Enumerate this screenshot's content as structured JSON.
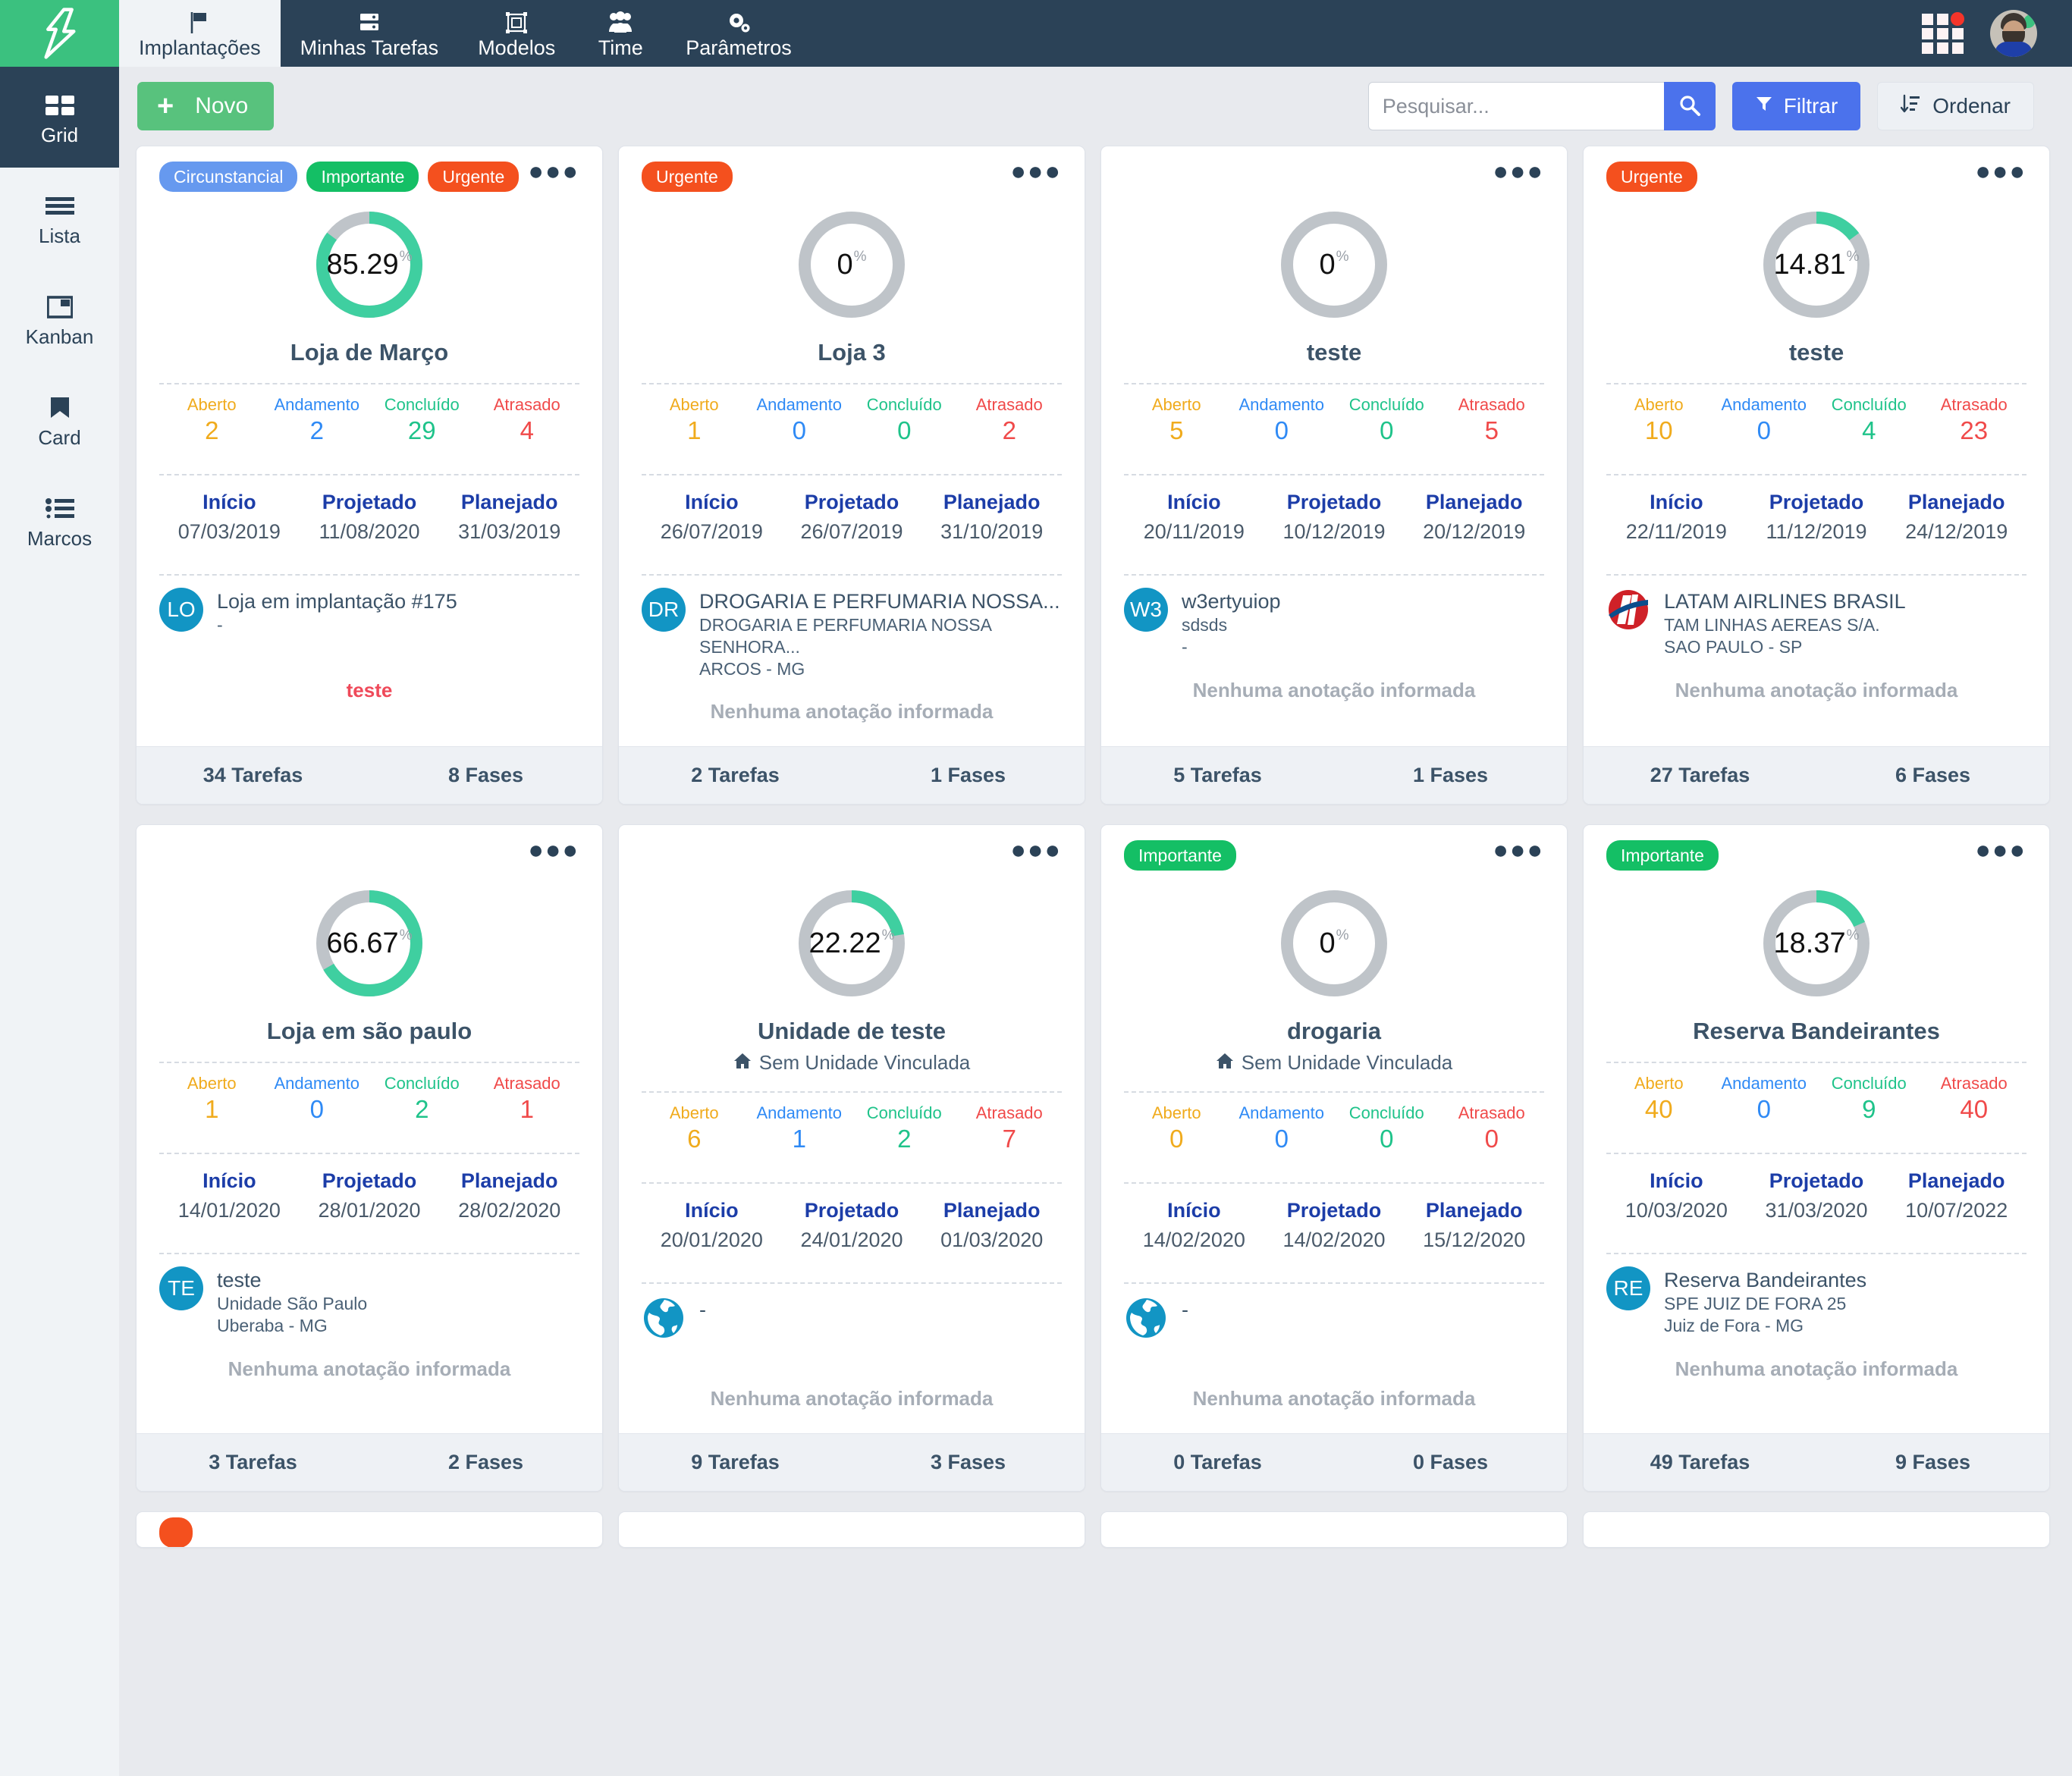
{
  "topnav": {
    "logo": "logo-mark",
    "items": [
      {
        "label": "Implantações",
        "icon": "flag-icon",
        "active": true
      },
      {
        "label": "Minhas Tarefas",
        "icon": "tasks-icon",
        "active": false
      },
      {
        "label": "Modelos",
        "icon": "template-icon",
        "active": false
      },
      {
        "label": "Time",
        "icon": "people-icon",
        "active": false
      },
      {
        "label": "Parâmetros",
        "icon": "gears-icon",
        "active": false
      }
    ],
    "apps_icon": "grid-apps-icon",
    "avatar": "user-avatar"
  },
  "sidebar": {
    "items": [
      {
        "label": "Grid",
        "icon": "grid-view-icon",
        "active": true
      },
      {
        "label": "Lista",
        "icon": "list-view-icon",
        "active": false
      },
      {
        "label": "Kanban",
        "icon": "kanban-view-icon",
        "active": false
      },
      {
        "label": "Card",
        "icon": "bookmark-icon",
        "active": false
      },
      {
        "label": "Marcos",
        "icon": "milestones-icon",
        "active": false
      }
    ]
  },
  "toolbar": {
    "new_label": "Novo",
    "new_icon": "plus-icon",
    "search_placeholder": "Pesquisar...",
    "search_value": "",
    "search_icon": "search-icon",
    "filter_label": "Filtrar",
    "filter_icon": "funnel-icon",
    "sort_label": "Ordenar",
    "sort_icon": "sort-desc-icon"
  },
  "labels": {
    "aberto": "Aberto",
    "andamento": "Andamento",
    "concluido": "Concluído",
    "atrasado": "Atrasado",
    "inicio": "Início",
    "projetado": "Projetado",
    "planejado": "Planejado",
    "no_note": "Nenhuma anotação informada",
    "tarefas_suffix": "Tarefas",
    "fases_suffix": "Fases"
  },
  "colors": {
    "brand_green": "#3bc17f",
    "nav_dark": "#2b4257",
    "accent_blue": "#4b72ec",
    "tag_circunstancial": "#6699ef",
    "tag_importante": "#14bf65",
    "tag_urgente": "#f4501e",
    "donut_fill": "#3fcfa0",
    "donut_track": "#bfc4c9",
    "stat_aberto": "#f0ab1d",
    "stat_andamento": "#2f8af5",
    "stat_concluido": "#1fc38a",
    "stat_atrasado": "#f04a4a"
  },
  "cards": [
    {
      "tags": [
        {
          "text": "Circunstancial",
          "kind": "circ"
        },
        {
          "text": "Importante",
          "kind": "imp"
        },
        {
          "text": "Urgente",
          "kind": "urg"
        }
      ],
      "percent": "85.29",
      "percent_value": 85.29,
      "title": "Loja de Março",
      "subtitle": "",
      "stats": {
        "aberto": "2",
        "andamento": "2",
        "concluido": "29",
        "atrasado": "4"
      },
      "dates": {
        "inicio": "07/03/2019",
        "projetado": "11/08/2020",
        "planejado": "31/03/2019"
      },
      "owner": {
        "avatar_type": "initials",
        "initials": "LO",
        "l1": "Loja em implantação #175",
        "l2": "-",
        "l3": ""
      },
      "note": "teste",
      "note_kind": "red",
      "foot_tasks": "34 Tarefas",
      "foot_phases": "8 Fases"
    },
    {
      "tags": [
        {
          "text": "Urgente",
          "kind": "urg"
        }
      ],
      "percent": "0",
      "percent_value": 0,
      "title": "Loja 3",
      "subtitle": "",
      "stats": {
        "aberto": "1",
        "andamento": "0",
        "concluido": "0",
        "atrasado": "2"
      },
      "dates": {
        "inicio": "26/07/2019",
        "projetado": "26/07/2019",
        "planejado": "31/10/2019"
      },
      "owner": {
        "avatar_type": "initials",
        "initials": "DR",
        "l1": "DROGARIA E PERFUMARIA NOSSA...",
        "l2": "DROGARIA E PERFUMARIA NOSSA SENHORA...",
        "l3": "ARCOS - MG"
      },
      "note": "Nenhuma anotação informada",
      "note_kind": "muted",
      "foot_tasks": "2 Tarefas",
      "foot_phases": "1 Fases"
    },
    {
      "tags": [],
      "percent": "0",
      "percent_value": 0,
      "title": "teste",
      "subtitle": "",
      "stats": {
        "aberto": "5",
        "andamento": "0",
        "concluido": "0",
        "atrasado": "5"
      },
      "dates": {
        "inicio": "20/11/2019",
        "projetado": "10/12/2019",
        "planejado": "20/12/2019"
      },
      "owner": {
        "avatar_type": "initials",
        "initials": "W3",
        "l1": "w3ertyuiop",
        "l2": "sdsds",
        "l3": "-"
      },
      "note": "Nenhuma anotação informada",
      "note_kind": "muted",
      "foot_tasks": "5 Tarefas",
      "foot_phases": "1 Fases"
    },
    {
      "tags": [
        {
          "text": "Urgente",
          "kind": "urg"
        }
      ],
      "percent": "14.81",
      "percent_value": 14.81,
      "title": "teste",
      "subtitle": "",
      "stats": {
        "aberto": "10",
        "andamento": "0",
        "concluido": "4",
        "atrasado": "23"
      },
      "dates": {
        "inicio": "22/11/2019",
        "projetado": "11/12/2019",
        "planejado": "24/12/2019"
      },
      "owner": {
        "avatar_type": "latam",
        "initials": "",
        "l1": "LATAM AIRLINES BRASIL",
        "l2": "TAM LINHAS AEREAS S/A.",
        "l3": "SAO PAULO - SP"
      },
      "note": "Nenhuma anotação informada",
      "note_kind": "muted",
      "foot_tasks": "27 Tarefas",
      "foot_phases": "6 Fases"
    },
    {
      "tags": [],
      "percent": "66.67",
      "percent_value": 66.67,
      "title": "Loja em são paulo",
      "subtitle": "",
      "stats": {
        "aberto": "1",
        "andamento": "0",
        "concluido": "2",
        "atrasado": "1"
      },
      "dates": {
        "inicio": "14/01/2020",
        "projetado": "28/01/2020",
        "planejado": "28/02/2020"
      },
      "owner": {
        "avatar_type": "initials",
        "initials": "TE",
        "l1": "teste",
        "l2": "Unidade São Paulo",
        "l3": "Uberaba - MG"
      },
      "note": "Nenhuma anotação informada",
      "note_kind": "muted",
      "foot_tasks": "3 Tarefas",
      "foot_phases": "2 Fases"
    },
    {
      "tags": [],
      "percent": "22.22",
      "percent_value": 22.22,
      "title": "Unidade de teste",
      "subtitle": "Sem Unidade Vinculada",
      "stats": {
        "aberto": "6",
        "andamento": "1",
        "concluido": "2",
        "atrasado": "7"
      },
      "dates": {
        "inicio": "20/01/2020",
        "projetado": "24/01/2020",
        "planejado": "01/03/2020"
      },
      "owner": {
        "avatar_type": "globe",
        "initials": "",
        "l1": "-",
        "l2": "",
        "l3": ""
      },
      "note": "Nenhuma anotação informada",
      "note_kind": "muted",
      "foot_tasks": "9 Tarefas",
      "foot_phases": "3 Fases"
    },
    {
      "tags": [
        {
          "text": "Importante",
          "kind": "imp"
        }
      ],
      "percent": "0",
      "percent_value": 0,
      "title": "drogaria",
      "subtitle": "Sem Unidade Vinculada",
      "stats": {
        "aberto": "0",
        "andamento": "0",
        "concluido": "0",
        "atrasado": "0"
      },
      "dates": {
        "inicio": "14/02/2020",
        "projetado": "14/02/2020",
        "planejado": "15/12/2020"
      },
      "owner": {
        "avatar_type": "globe",
        "initials": "",
        "l1": "-",
        "l2": "",
        "l3": ""
      },
      "note": "Nenhuma anotação informada",
      "note_kind": "muted",
      "foot_tasks": "0 Tarefas",
      "foot_phases": "0 Fases"
    },
    {
      "tags": [
        {
          "text": "Importante",
          "kind": "imp"
        }
      ],
      "percent": "18.37",
      "percent_value": 18.37,
      "title": "Reserva Bandeirantes",
      "subtitle": "",
      "stats": {
        "aberto": "40",
        "andamento": "0",
        "concluido": "9",
        "atrasado": "40"
      },
      "dates": {
        "inicio": "10/03/2020",
        "projetado": "31/03/2020",
        "planejado": "10/07/2022"
      },
      "owner": {
        "avatar_type": "initials",
        "initials": "RE",
        "l1": "Reserva Bandeirantes",
        "l2": "SPE JUIZ DE FORA 25",
        "l3": "Juiz de Fora - MG"
      },
      "note": "Nenhuma anotação informada",
      "note_kind": "muted",
      "foot_tasks": "49 Tarefas",
      "foot_phases": "9 Fases"
    }
  ],
  "partial_row": {
    "count": 4,
    "first_card_tag": {
      "text": "",
      "kind": "urg"
    }
  }
}
